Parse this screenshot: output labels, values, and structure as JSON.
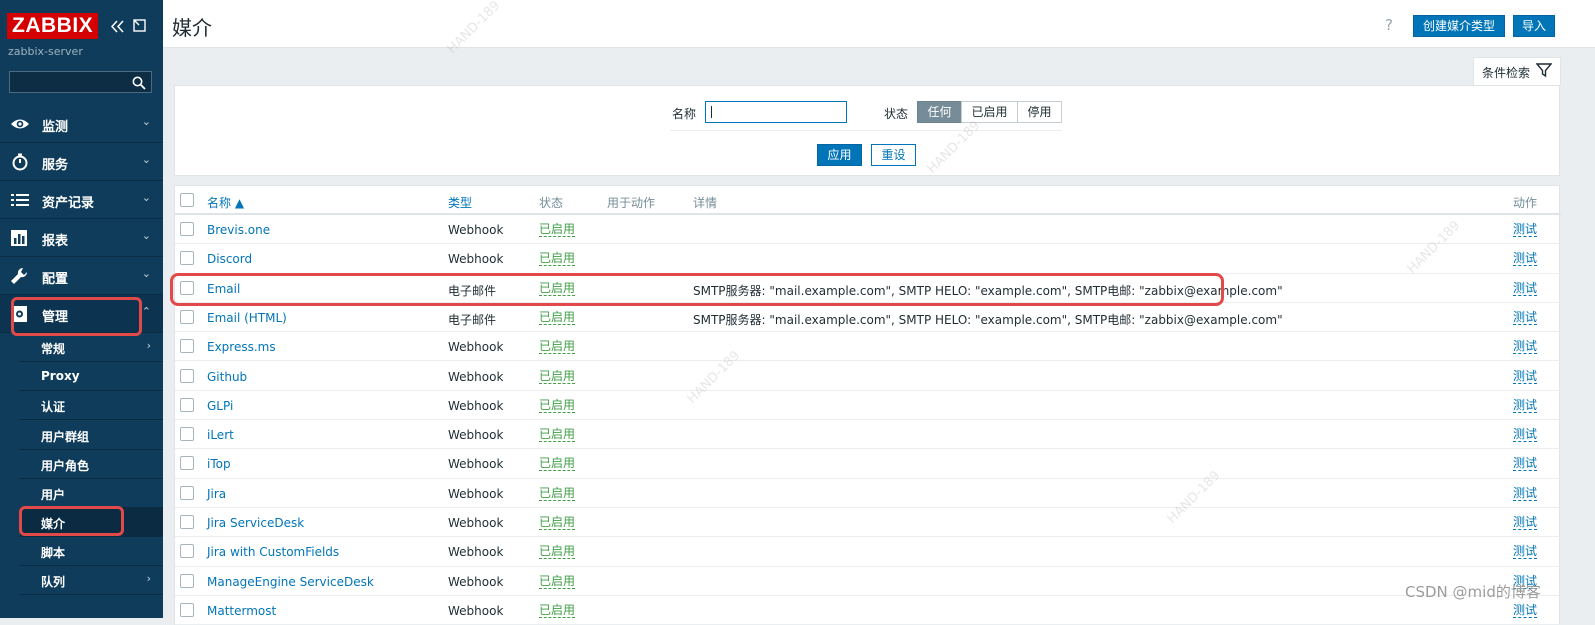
{
  "sidebar": {
    "logo": "ZABBIX",
    "server_name": "zabbix-server",
    "search_placeholder": "",
    "menu": [
      {
        "label": "监测",
        "icon": "eye-icon"
      },
      {
        "label": "服务",
        "icon": "stopwatch-icon"
      },
      {
        "label": "资产记录",
        "icon": "list-icon"
      },
      {
        "label": "报表",
        "icon": "bar-chart-icon"
      },
      {
        "label": "配置",
        "icon": "wrench-icon"
      },
      {
        "label": "管理",
        "icon": "admin-gear-icon"
      }
    ],
    "submenu": [
      "常规",
      "Proxy",
      "认证",
      "用户群组",
      "用户角色",
      "用户",
      "媒介",
      "脚本",
      "队列"
    ],
    "selected_submenu": "媒介"
  },
  "header": {
    "title": "媒介",
    "help": "?",
    "create_button": "创建媒介类型",
    "import_button": "导入"
  },
  "filter": {
    "tab_label": "条件检索",
    "name_label": "名称",
    "name_value": "",
    "status_label": "状态",
    "status_options": [
      "任何",
      "已启用",
      "停用"
    ],
    "status_selected": "任何",
    "apply_button": "应用",
    "reset_button": "重设"
  },
  "table": {
    "columns": {
      "name": "名称 ▲",
      "type": "类型",
      "status": "状态",
      "used_in_actions": "用于动作",
      "details": "详情",
      "action": "动作"
    },
    "rows": [
      {
        "name": "Brevis.one",
        "type": "Webhook",
        "status": "已启用",
        "details": "",
        "action": "测试"
      },
      {
        "name": "Discord",
        "type": "Webhook",
        "status": "已启用",
        "details": "",
        "action": "测试"
      },
      {
        "name": "Email",
        "type": "电子邮件",
        "status": "已启用",
        "details": "SMTP服务器: \"mail.example.com\", SMTP HELO: \"example.com\", SMTP电邮: \"zabbix@example.com\"",
        "action": "测试"
      },
      {
        "name": "Email (HTML)",
        "type": "电子邮件",
        "status": "已启用",
        "details": "SMTP服务器: \"mail.example.com\", SMTP HELO: \"example.com\", SMTP电邮: \"zabbix@example.com\"",
        "action": "测试"
      },
      {
        "name": "Express.ms",
        "type": "Webhook",
        "status": "已启用",
        "details": "",
        "action": "测试"
      },
      {
        "name": "Github",
        "type": "Webhook",
        "status": "已启用",
        "details": "",
        "action": "测试"
      },
      {
        "name": "GLPi",
        "type": "Webhook",
        "status": "已启用",
        "details": "",
        "action": "测试"
      },
      {
        "name": "iLert",
        "type": "Webhook",
        "status": "已启用",
        "details": "",
        "action": "测试"
      },
      {
        "name": "iTop",
        "type": "Webhook",
        "status": "已启用",
        "details": "",
        "action": "测试"
      },
      {
        "name": "Jira",
        "type": "Webhook",
        "status": "已启用",
        "details": "",
        "action": "测试"
      },
      {
        "name": "Jira ServiceDesk",
        "type": "Webhook",
        "status": "已启用",
        "details": "",
        "action": "测试"
      },
      {
        "name": "Jira with CustomFields",
        "type": "Webhook",
        "status": "已启用",
        "details": "",
        "action": "测试"
      },
      {
        "name": "ManageEngine ServiceDesk",
        "type": "Webhook",
        "status": "已启用",
        "details": "",
        "action": "测试"
      },
      {
        "name": "Mattermost",
        "type": "Webhook",
        "status": "已启用",
        "details": "",
        "action": "测试"
      }
    ]
  },
  "overlay": {
    "csdn_watermark": "CSDN @mid的博客",
    "diagonal_watermark": "HAND-189"
  },
  "colors": {
    "sidebar_bg": "#0f3c5a",
    "accent_blue": "#0275b8",
    "enabled_green": "#429e47",
    "highlight_red": "#e24a4a",
    "logo_red": "#d40000"
  }
}
